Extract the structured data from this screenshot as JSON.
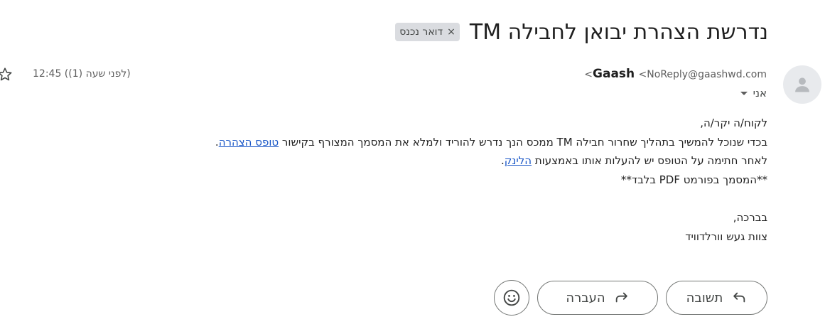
{
  "email": {
    "subject": "נדרשת הצהרת יבואן לחבילה TM",
    "label_chip": {
      "text": "דואר נכנס",
      "remove_glyph": "×"
    },
    "sender": {
      "name": "Gaash",
      "email": "<NoReply@gaashwd.com>"
    },
    "recipient": "אני",
    "timestamp": "12:45 (לפני שעה (1))",
    "body": {
      "greeting": "לקוח/ה יקר/ה,",
      "line1_prefix": "בכדי שנוכל להמשיך בתהליך שחרור חבילה TM ממכס הנך נדרש להוריד ולמלא את המסמך המצורף בקישור ",
      "line1_link": "טופס הצהרה",
      "line1_suffix": ".",
      "line2_prefix": "לאחר חתימה על הטופס יש להעלות אותו באמצעות ",
      "line2_link": "הלינק",
      "line2_suffix": ".",
      "line3": "**המסמך בפורמט PDF בלבד**",
      "signoff": "בברכה,",
      "signature": "צוות געש וורלדוויד"
    }
  },
  "actions": {
    "reply_label": "תשובה",
    "forward_label": "העברה"
  },
  "icons": {
    "avatar": "person-icon",
    "star": "star-outline-icon",
    "reply": "reply-arrow-icon",
    "forward": "forward-arrow-icon",
    "emoji": "smiley-icon"
  },
  "colors": {
    "link": "#1a57c7",
    "chip_bg": "#dadce0",
    "avatar_bg": "#e8eaed"
  }
}
